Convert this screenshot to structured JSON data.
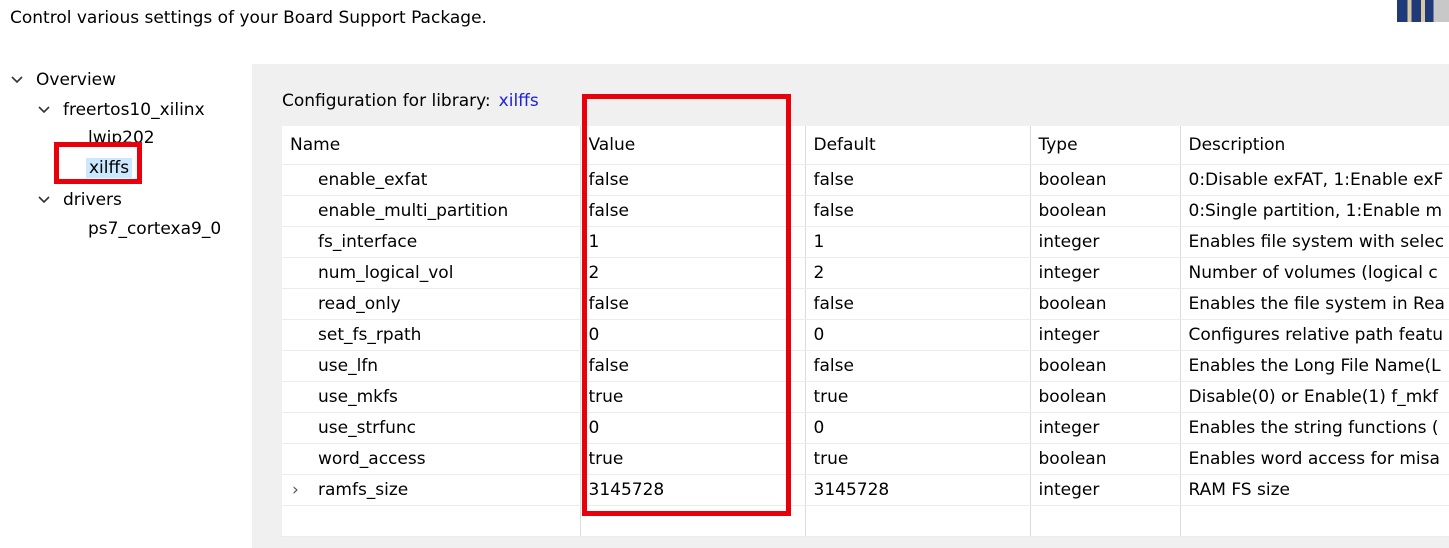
{
  "header": {
    "description": "Control various settings of your Board Support Package."
  },
  "tree": {
    "overview": "Overview",
    "freertos": "freertos10_xilinx",
    "lwip": "lwip202",
    "xilffs": "xilffs",
    "drivers": "drivers",
    "ps7": "ps7_cortexa9_0"
  },
  "config": {
    "label": "Configuration for library:",
    "library": "xilffs"
  },
  "table": {
    "columns": [
      "Name",
      "Value",
      "Default",
      "Type",
      "Description"
    ],
    "rows": [
      {
        "name": "enable_exfat",
        "value": "false",
        "default": "false",
        "type": "boolean",
        "description": "0:Disable exFAT, 1:Enable exF"
      },
      {
        "name": "enable_multi_partition",
        "value": "false",
        "default": "false",
        "type": "boolean",
        "description": "0:Single partition, 1:Enable m"
      },
      {
        "name": "fs_interface",
        "value": "1",
        "default": "1",
        "type": "integer",
        "description": "Enables file system with selec"
      },
      {
        "name": "num_logical_vol",
        "value": "2",
        "default": "2",
        "type": "integer",
        "description": "Number of volumes (logical c"
      },
      {
        "name": "read_only",
        "value": "false",
        "default": "false",
        "type": "boolean",
        "description": "Enables the file system in Rea"
      },
      {
        "name": "set_fs_rpath",
        "value": "0",
        "default": "0",
        "type": "integer",
        "description": "Configures relative path featu"
      },
      {
        "name": "use_lfn",
        "value": "false",
        "default": "false",
        "type": "boolean",
        "description": "Enables the Long File Name(L"
      },
      {
        "name": "use_mkfs",
        "value": "true",
        "default": "true",
        "type": "boolean",
        "description": "Disable(0) or Enable(1) f_mkf"
      },
      {
        "name": "use_strfunc",
        "value": "0",
        "default": "0",
        "type": "integer",
        "description": "Enables the string functions ("
      },
      {
        "name": "word_access",
        "value": "true",
        "default": "true",
        "type": "boolean",
        "description": "Enables word access for misa"
      },
      {
        "name": "ramfs_size",
        "value": "3145728",
        "default": "3145728",
        "type": "integer",
        "description": "RAM FS size"
      }
    ]
  },
  "colors": {
    "highlight": "#e8000a",
    "link": "#1f22d6",
    "selection": "#cce8ff"
  }
}
